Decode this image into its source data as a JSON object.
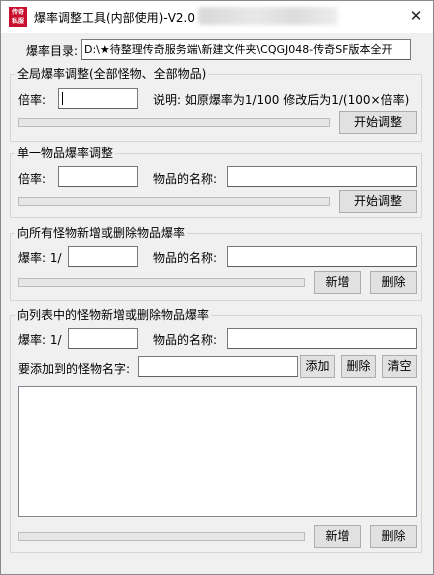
{
  "window": {
    "title": "爆率调整工具(内部使用)-V2.0",
    "close_symbol": "✕",
    "icon_text_1": "传奇",
    "icon_text_2": "私服"
  },
  "directory": {
    "label": "爆率目录:",
    "value": "D:\\★待整理传奇服务端\\新建文件夹\\CQGJ048-传奇SF版本全开"
  },
  "global_group": {
    "title": "全局爆率调整(全部怪物、全部物品)",
    "multiplier_label": "倍率:",
    "multiplier_value": "",
    "note": "说明: 如原爆率为1/100  修改后为1/(100×倍率)",
    "start_button": "开始调整",
    "progress": 0
  },
  "single_group": {
    "title": "单一物品爆率调整",
    "multiplier_label": "倍率:",
    "multiplier_value": "",
    "item_name_label": "物品的名称:",
    "item_name_value": "",
    "start_button": "开始调整",
    "progress": 0
  },
  "all_monsters_group": {
    "title": "向所有怪物新增或删除物品爆率",
    "rate_label": "爆率: 1/",
    "rate_value": "",
    "item_name_label": "物品的名称:",
    "item_name_value": "",
    "add_button": "新增",
    "delete_button": "删除",
    "progress": 0
  },
  "list_monsters_group": {
    "title": "向列表中的怪物新增或删除物品爆率",
    "rate_label": "爆率: 1/",
    "rate_value": "",
    "item_name_label": "物品的名称:",
    "item_name_value": "",
    "monster_name_label": "要添加到的怪物名字:",
    "monster_name_value": "",
    "list_add_button": "添加",
    "list_delete_button": "删除",
    "list_clear_button": "清空",
    "monster_list": [],
    "add_button": "新增",
    "delete_button": "删除",
    "progress": 0
  },
  "colors": {
    "progress_fill": "#06b025",
    "window_bg": "#f0f0f0"
  }
}
